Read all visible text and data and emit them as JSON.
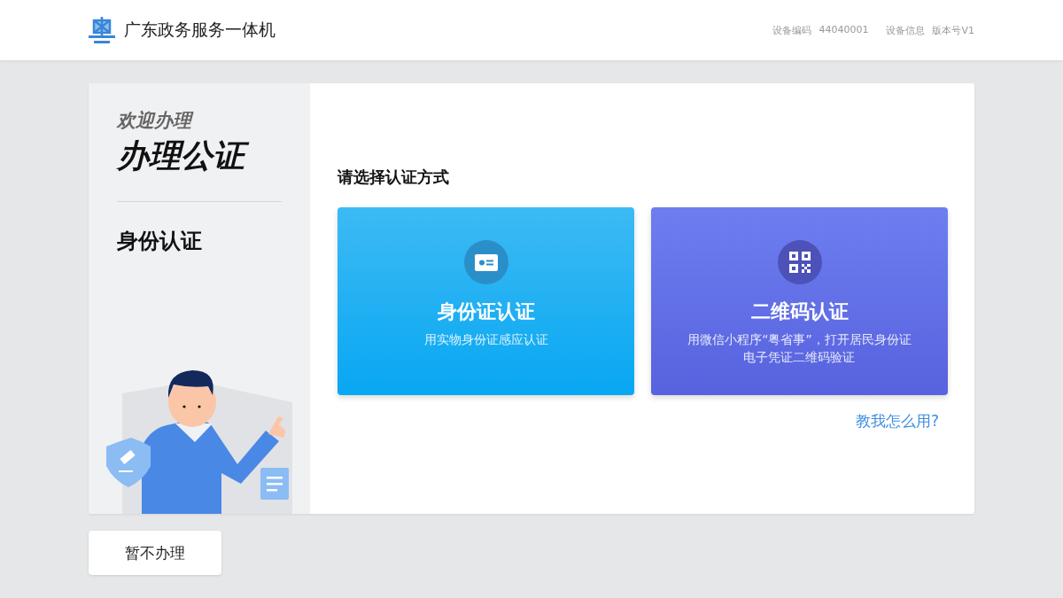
{
  "header": {
    "title": "广东政务服务一体机",
    "device_code_label": "设备编码",
    "device_code": "44040001",
    "device_info": "设备信息",
    "version": "版本号V1"
  },
  "sidebar": {
    "welcome": "欢迎办理",
    "title": "办理公证",
    "step": "身份认证"
  },
  "main": {
    "prompt": "请选择认证方式",
    "options": [
      {
        "kind": "id",
        "title": "身份证认证",
        "description_lines": [
          "用实物身份证感应认证"
        ]
      },
      {
        "kind": "qr",
        "title": "二维码认证",
        "description_lines": [
          "用微信小程序“粤省事”，打开居民身份证",
          "电子凭证二维码验证"
        ]
      }
    ],
    "help_link": "教我怎么用?"
  },
  "footer": {
    "cancel_button": "暂不办理"
  }
}
